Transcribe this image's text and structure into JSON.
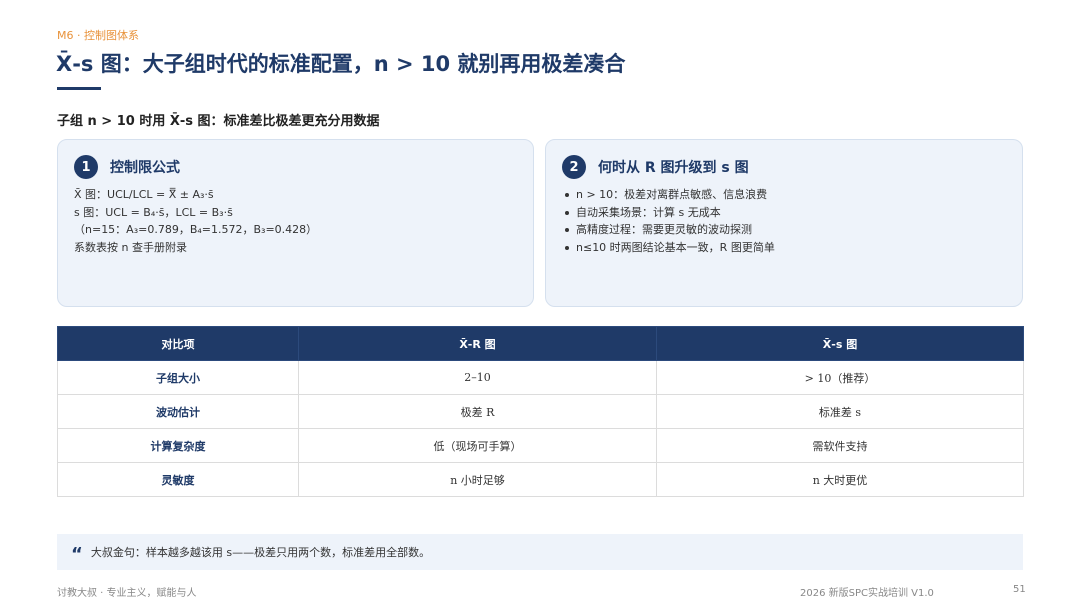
{
  "header": {
    "section_tag": "M6 · 控制图体系",
    "title": "X̄-s 图：大子组时代的标准配置，n > 10 就别再用极差凑合",
    "subtitle": "子组 n > 10 时用 X̄-s 图：标准差比极差更充分用数据"
  },
  "cards": [
    {
      "number": "1",
      "title": "控制限公式",
      "lines": [
        "X̄ 图：UCL/LCL = X̿ ± A₃·s̄",
        "s 图：UCL = B₄·s̄，LCL = B₃·s̄",
        "（n=15：A₃=0.789，B₄=1.572，B₃=0.428）",
        "系数表按 n 查手册附录"
      ]
    },
    {
      "number": "2",
      "title": "何时从 R 图升级到 s 图",
      "bullets": [
        "n > 10：极差对离群点敏感、信息浪费",
        "自动采集场景：计算 s 无成本",
        "高精度过程：需要更灵敏的波动探测",
        "n≤10 时两图结论基本一致，R 图更简单"
      ]
    }
  ],
  "table": {
    "headers": [
      "对比项",
      "X̄-R 图",
      "X̄-s 图"
    ],
    "rows": [
      [
        "子组大小",
        "2–10",
        "> 10（推荐）"
      ],
      [
        "波动估计",
        "极差 R",
        "标准差 s"
      ],
      [
        "计算复杂度",
        "低（现场可手算）",
        "需软件支持"
      ],
      [
        "灵敏度",
        "n 小时足够",
        "n 大时更优"
      ]
    ]
  },
  "quote": {
    "icon": "quote-icon",
    "text": "大叔金句：样本越多越该用 s——极差只用两个数，标准差用全部数。"
  },
  "footer": {
    "left": "讨教大叔 · 专业主义，赋能与人",
    "right": "2026 新版SPC实战培训 V1.0",
    "page": "51"
  },
  "colors": {
    "primary": "#1f3a68",
    "accent": "#e8923a",
    "card_bg": "#eef3fa"
  }
}
